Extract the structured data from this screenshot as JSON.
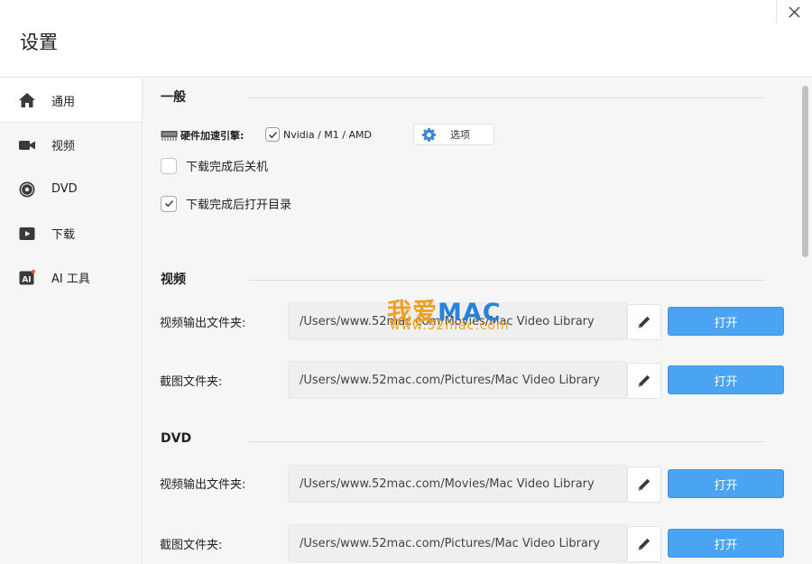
{
  "window": {
    "title": "设置"
  },
  "sidebar": {
    "items": [
      {
        "label": "通用",
        "icon": "home-icon",
        "active": true
      },
      {
        "label": "视频",
        "icon": "video-camera-icon"
      },
      {
        "label": "DVD",
        "icon": "disc-icon"
      },
      {
        "label": "下载",
        "icon": "play-icon"
      },
      {
        "label": "AI 工具",
        "icon": "ai-icon"
      }
    ]
  },
  "general": {
    "title": "一般",
    "hardware": {
      "label": "硬件加速引擎:",
      "option_label": "Nvidia /  M1 / AMD",
      "checked": true,
      "options_button": "选项"
    },
    "shutdown_after_download": {
      "label": "下载完成后关机",
      "checked": false
    },
    "open_folder_after_download": {
      "label": "下载完成后打开目录",
      "checked": true
    }
  },
  "video": {
    "title": "视频",
    "output_folder": {
      "label": "视频输出文件夹:",
      "value": "/Users/www.52mac.com/Movies/Mac Video Library",
      "open_label": "打开"
    },
    "screenshot_folder": {
      "label": "截图文件夹:",
      "value": "/Users/www.52mac.com/Pictures/Mac Video Library",
      "open_label": "打开"
    }
  },
  "dvd": {
    "title": "DVD",
    "output_folder": {
      "label": "视频输出文件夹:",
      "value": "/Users/www.52mac.com/Movies/Mac Video Library",
      "open_label": "打开"
    },
    "screenshot_folder": {
      "label": "截图文件夹:",
      "value": "/Users/www.52mac.com/Pictures/Mac Video Library",
      "open_label": "打开"
    }
  },
  "watermark": {
    "text_cn": "我爱",
    "text_mac": "MAC",
    "url": "www.52mac.com"
  },
  "colors": {
    "accent": "#4aa3f3",
    "sidebar_bg": "#f6f6f6",
    "watermark_orange": "#f0a020",
    "watermark_blue": "#2a82d6"
  }
}
